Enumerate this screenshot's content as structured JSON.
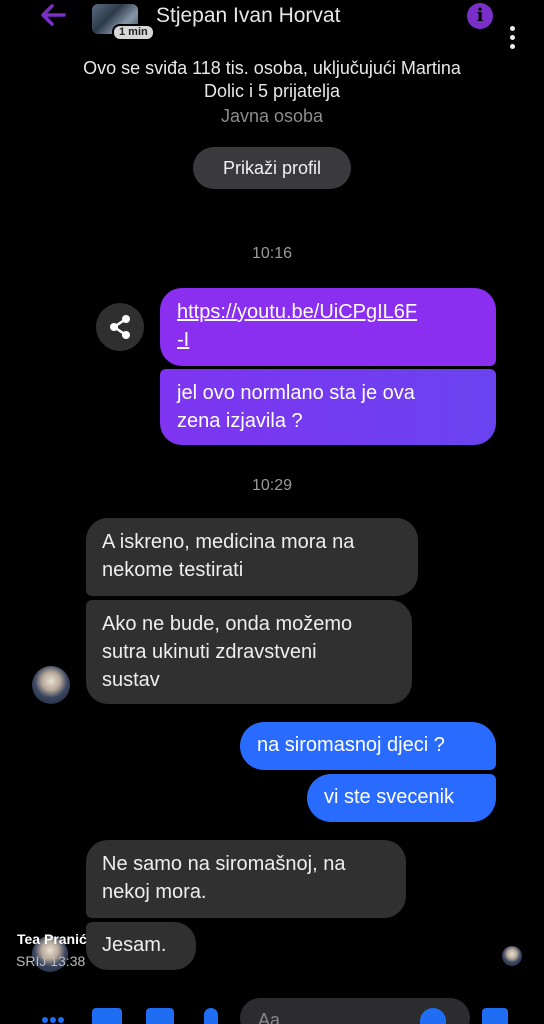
{
  "header": {
    "contact_name": "Stjepan Ivan Horvat",
    "avatar_badge": "1 min",
    "accent_color": "#8a2ef0"
  },
  "profile": {
    "likes_line1": "Ovo se sviđa 118 tis. osoba, uključujući Martina",
    "likes_line2": "Dolic i 5 prijatelja",
    "category": "Javna osoba",
    "view_profile_label": "Prikaži profil"
  },
  "conversation": {
    "time1": "10:16",
    "link_line1": "https://youtu.be/UiCPgIL6F",
    "link_line2": "-I",
    "msg_question_line1": "jel ovo normlano  sta je ova",
    "msg_question_line2": "zena izjavila ?",
    "time2": "10:29",
    "reply1_line1": "A iskreno, medicina mora na",
    "reply1_line2": "nekome testirati",
    "reply2_line1": "Ako ne bude, onda možemo",
    "reply2_line2": "sutra ukinuti zdravstveni",
    "reply2_line3": "sustav",
    "out_msg1": "na siromasnoj djeci ?",
    "out_msg2": "vi ste svecenik",
    "reply3_line1": "Ne samo na siromašnoj, na",
    "reply3_line2": "nekoj mora.",
    "reply4": "Jesam."
  },
  "footer": {
    "poster_name": "Tea Pranić",
    "post_time": "SRIJ 13:38",
    "composer_placeholder": "Aa"
  }
}
